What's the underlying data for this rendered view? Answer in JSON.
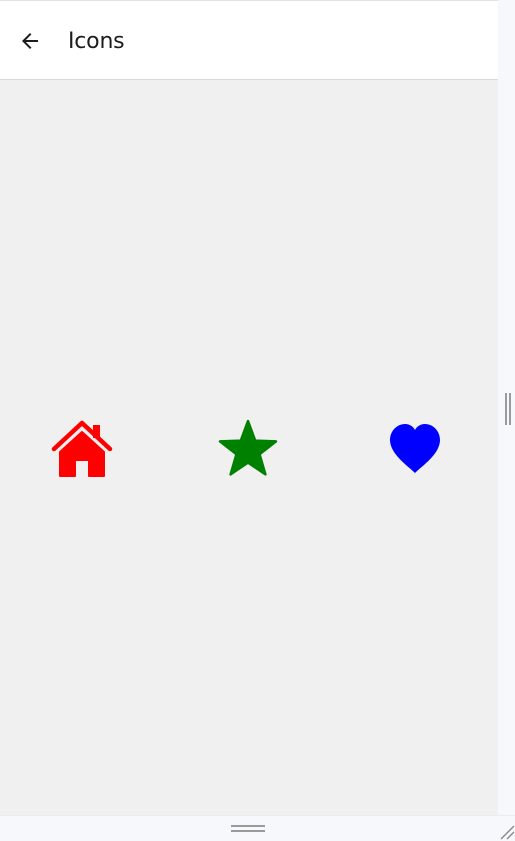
{
  "app_bar": {
    "title": "Icons",
    "back_icon": "arrow-left-icon"
  },
  "icons": [
    {
      "name": "home-icon",
      "color": "#ff0000"
    },
    {
      "name": "star-icon",
      "color": "#008000"
    },
    {
      "name": "heart-icon",
      "color": "#0000ff"
    }
  ],
  "colors": {
    "background": "#f0f0f0",
    "app_bar": "#ffffff",
    "title_text": "#1c1c1c"
  }
}
